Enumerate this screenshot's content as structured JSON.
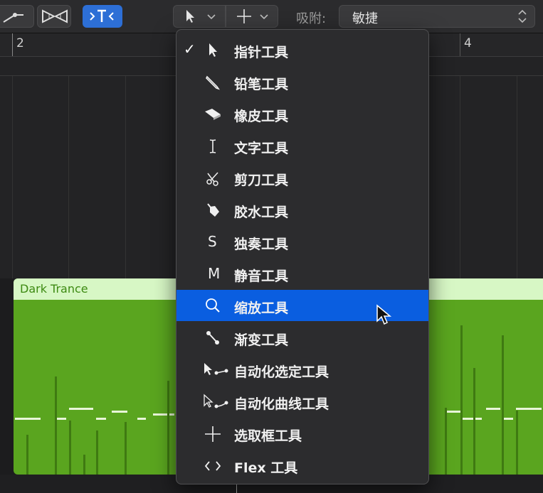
{
  "toolbar": {
    "snap_label": "吸附:",
    "snap_value": "敏捷"
  },
  "ruler": {
    "bar_2": "2",
    "bar_4": "4"
  },
  "region": {
    "name": "Dark Trance"
  },
  "tool_menu": {
    "items": [
      {
        "label": "指针工具",
        "icon": "pointer-icon",
        "checked": true
      },
      {
        "label": "铅笔工具",
        "icon": "pencil-icon"
      },
      {
        "label": "橡皮工具",
        "icon": "eraser-icon"
      },
      {
        "label": "文字工具",
        "icon": "text-cursor-icon"
      },
      {
        "label": "剪刀工具",
        "icon": "scissors-icon"
      },
      {
        "label": "胶水工具",
        "icon": "glue-icon"
      },
      {
        "label": "独奏工具",
        "icon": "solo-icon",
        "letter": "S"
      },
      {
        "label": "静音工具",
        "icon": "mute-icon",
        "letter": "M"
      },
      {
        "label": "缩放工具",
        "icon": "zoom-icon",
        "highlighted": true
      },
      {
        "label": "渐变工具",
        "icon": "fade-icon"
      },
      {
        "label": "自动化选定工具",
        "icon": "automation-select-icon"
      },
      {
        "label": "自动化曲线工具",
        "icon": "automation-curve-icon"
      },
      {
        "label": "选取框工具",
        "icon": "marquee-icon"
      },
      {
        "label": "Flex 工具",
        "icon": "flex-icon"
      }
    ],
    "check_mark": "✓"
  },
  "colors": {
    "highlight": "#0a5ee0",
    "region_body": "#5aa51f",
    "region_header": "#d7f7c5"
  }
}
